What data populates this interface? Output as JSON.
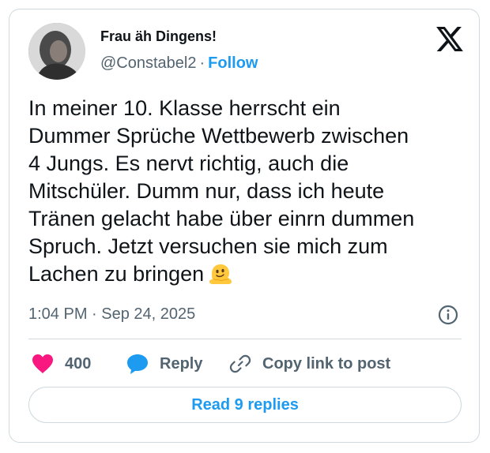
{
  "author": {
    "display_name": "Frau äh Dingens!",
    "handle": "@Constabel2",
    "separator": "·",
    "follow_label": "Follow"
  },
  "tweet": {
    "lines": [
      "In meiner 10. Klasse herrscht ein",
      "Dummer Sprüche Wettbewerb zwischen",
      "4 Jungs. Es nervt richtig, auch die",
      "Mitschüler. Dumm nur, dass ich heute",
      "Tränen gelacht habe über einrn dummen",
      "Spruch. Jetzt versuchen sie mich zum",
      "Lachen zu bringen"
    ],
    "emoji": "melting-face-emoji",
    "timestamp": "1:04 PM · Sep 24, 2025"
  },
  "actions": {
    "like_count": "400",
    "reply_label": "Reply",
    "copy_label": "Copy link to post"
  },
  "footer": {
    "read_replies_label": "Read 9 replies"
  },
  "icons": {
    "logo": "x-logo-icon",
    "info": "info-icon",
    "like": "heart-icon",
    "reply": "speech-bubble-icon",
    "copy": "link-icon"
  },
  "colors": {
    "accent": "#1d9bf0",
    "like": "#f91880",
    "text": "#0f1419",
    "muted": "#536471",
    "border": "#cfd9de"
  }
}
